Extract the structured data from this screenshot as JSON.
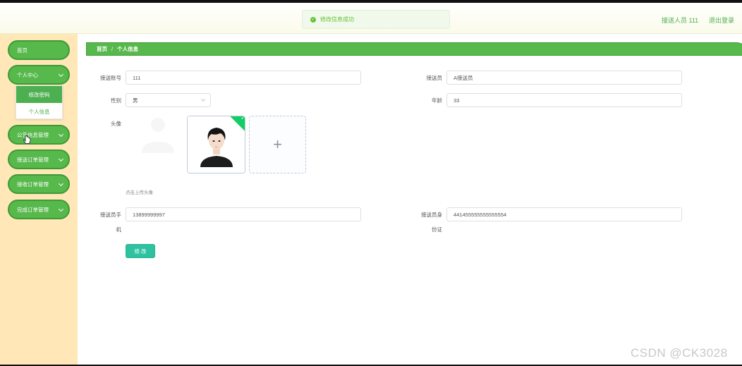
{
  "header": {
    "toast": "修改信息成功",
    "user_info": "接送人员 111",
    "logout_label": "退出登录"
  },
  "sidebar": {
    "items": [
      {
        "label": "首页"
      },
      {
        "label": "个人中心"
      },
      {
        "label": "公告信息管理"
      },
      {
        "label": "接送订单管理"
      },
      {
        "label": "接收订单管理"
      },
      {
        "label": "完成订单管理"
      }
    ],
    "submenu": [
      {
        "label": "修改密码"
      },
      {
        "label": "个人信息"
      }
    ]
  },
  "breadcrumb": {
    "home": "首页",
    "separator": "/",
    "current": "个人信息"
  },
  "form": {
    "account_label": "接送账号",
    "account_value": "111",
    "name_label": "接送员",
    "name_value": "A接送员",
    "gender_label": "性别",
    "gender_value": "男",
    "age_label": "年龄",
    "age_value": "33",
    "avatar_label": "头像",
    "upload_hint": "点击上传头像",
    "phone_label_1": "接送员手",
    "phone_label_2": "机",
    "phone_value": "13899999997",
    "idcard_label_1": "接送员身",
    "idcard_label_2": "份证",
    "idcard_value": "441455555555555554",
    "submit_label": "修 改"
  },
  "watermark": "CSDN @CK3028",
  "colors": {
    "accent_green": "#57b84c",
    "sidebar_bg": "#ffe7b8",
    "submit_teal": "#2fc2a0",
    "success_check": "#13ce66"
  }
}
